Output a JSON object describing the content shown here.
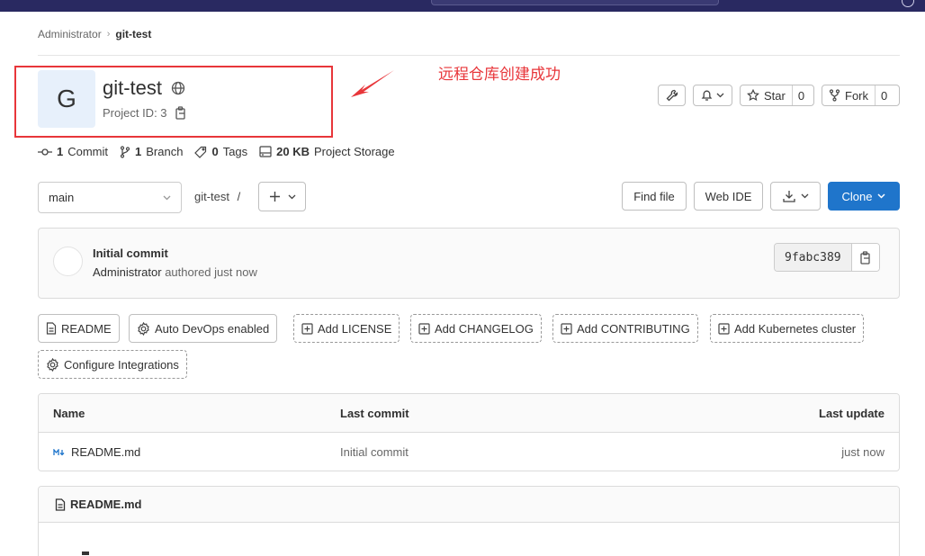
{
  "breadcrumb": {
    "parent": "Administrator",
    "current": "git-test"
  },
  "project": {
    "avatar_letter": "G",
    "name": "git-test",
    "id_label": "Project ID: 3",
    "visibility_icon": "globe-icon"
  },
  "annotation": {
    "text": "远程仓库创建成功",
    "color": "#e8363a"
  },
  "actions": {
    "star_label": "Star",
    "star_count": "0",
    "fork_label": "Fork",
    "fork_count": "0"
  },
  "stats": {
    "commits_count": "1",
    "commits_label": "Commit",
    "branches_count": "1",
    "branches_label": "Branch",
    "tags_count": "0",
    "tags_label": "Tags",
    "storage_size": "20 KB",
    "storage_label": "Project Storage"
  },
  "repo_nav": {
    "branch": "main",
    "path": "git-test",
    "path_sep": "/",
    "find_file": "Find file",
    "web_ide": "Web IDE",
    "clone": "Clone"
  },
  "last_commit": {
    "title": "Initial commit",
    "author": "Administrator",
    "meta": "authored just now",
    "sha": "9fabc389"
  },
  "quick_actions": {
    "readme": "README",
    "auto_devops": "Auto DevOps enabled",
    "add_license": "Add LICENSE",
    "add_changelog": "Add CHANGELOG",
    "add_contributing": "Add CONTRIBUTING",
    "add_k8s": "Add Kubernetes cluster",
    "configure_integrations": "Configure Integrations"
  },
  "file_tree": {
    "headers": {
      "name": "Name",
      "last_commit": "Last commit",
      "last_update": "Last update"
    },
    "rows": [
      {
        "name": "README.md",
        "last_commit": "Initial commit",
        "last_update": "just now"
      }
    ]
  },
  "readme_panel": {
    "title": "README.md"
  },
  "colors": {
    "accent": "#1f75cb",
    "nav_bg": "#292961",
    "annotation": "#e8363a"
  }
}
